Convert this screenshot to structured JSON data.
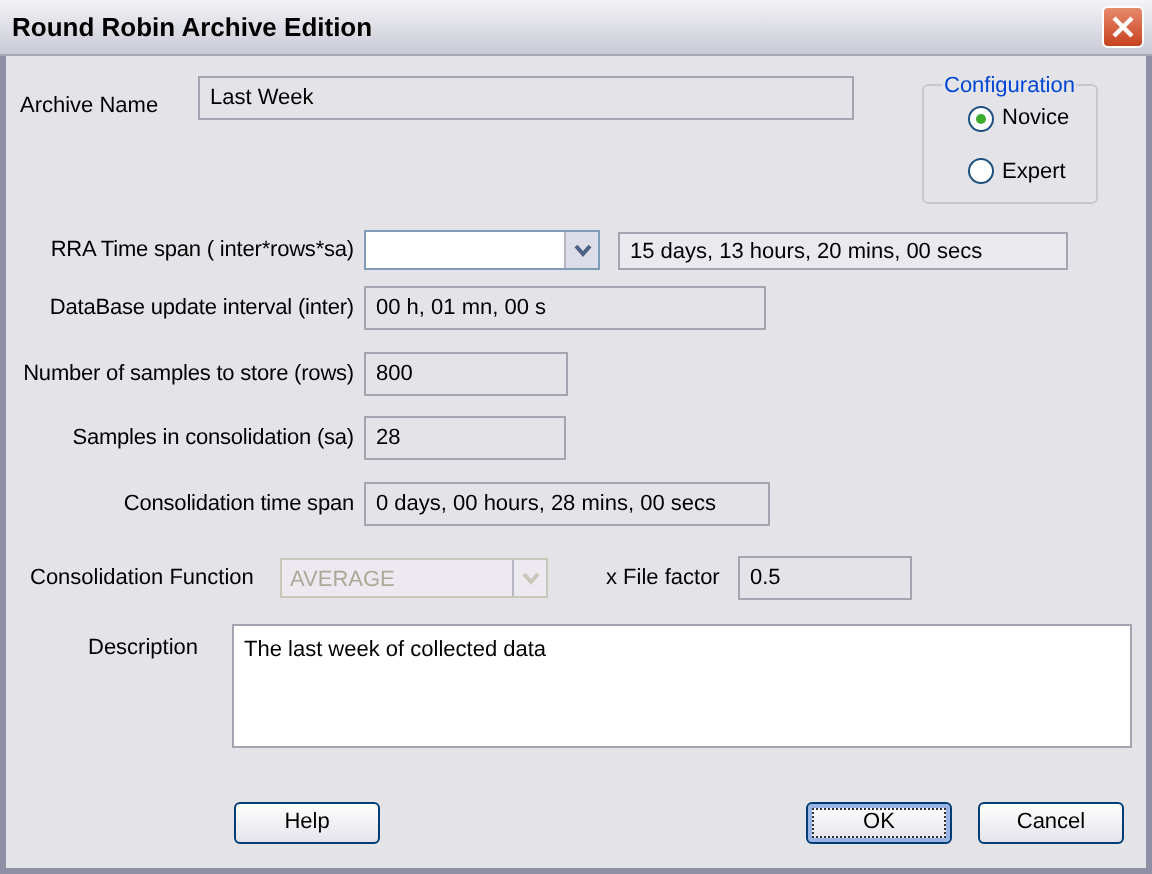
{
  "window": {
    "title": "Round Robin Archive Edition"
  },
  "archive_name": {
    "label": "Archive Name",
    "value": "Last Week"
  },
  "configuration": {
    "title": "Configuration",
    "options": [
      {
        "label": "Novice",
        "selected": true
      },
      {
        "label": "Expert",
        "selected": false
      }
    ]
  },
  "rra_time_span": {
    "label": "RRA Time span  ( inter*rows*sa)",
    "disabled": false,
    "readout": "15 days, 13 hours, 20 mins, 00 secs"
  },
  "update_interval": {
    "label": "DataBase update interval (inter)",
    "value": "00 h, 01 mn, 00 s"
  },
  "samples_to_store": {
    "label": "Number of samples to store (rows)",
    "value": "800"
  },
  "samples_in_consolidation": {
    "label": "Samples in consolidation (sa)",
    "value": "28"
  },
  "consolidation_time_span": {
    "label": "Consolidation time span",
    "value": "0 days, 00 hours, 28 mins, 00 secs"
  },
  "consolidation_function": {
    "label": "Consolidation Function",
    "value": "AVERAGE",
    "disabled": true
  },
  "file_factor": {
    "label": "x File factor",
    "value": "0.5"
  },
  "description": {
    "label": "Description",
    "value": "The last week of collected data"
  },
  "buttons": [
    {
      "label": "Help",
      "focused": false
    },
    {
      "label": "OK",
      "focused": true
    },
    {
      "label": "Cancel",
      "focused": false
    }
  ]
}
